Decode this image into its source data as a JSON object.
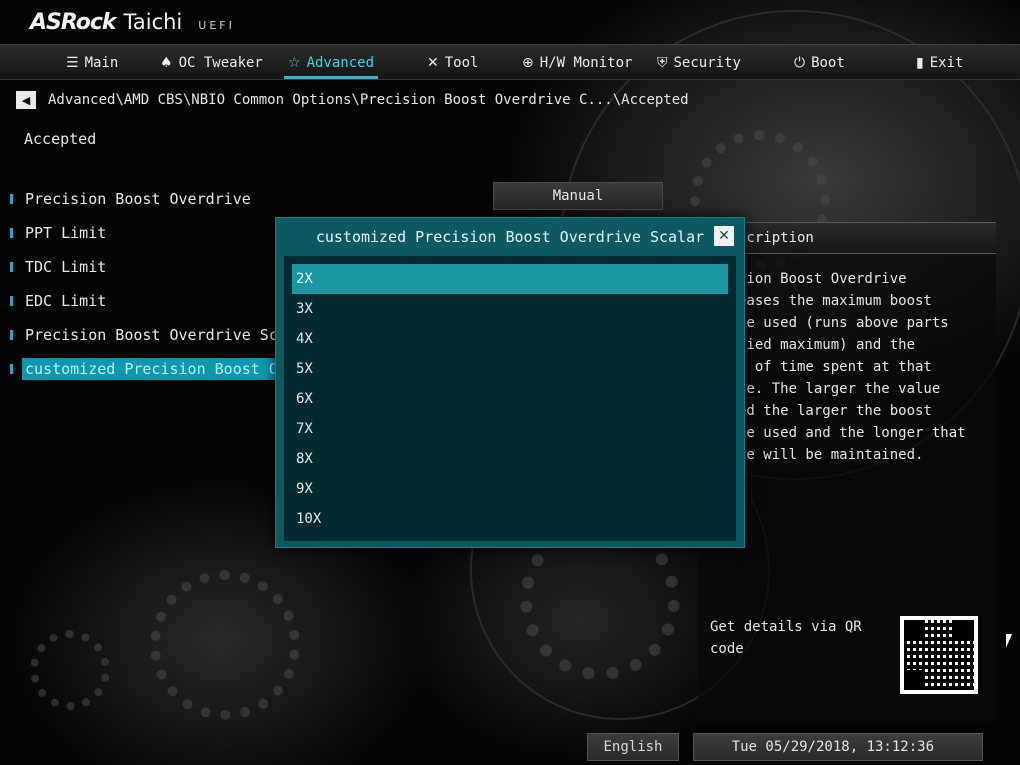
{
  "header": {
    "brand": "ASRock",
    "model": "Taichi",
    "firmware": "UEFI"
  },
  "menu": {
    "tabs": [
      {
        "label": "Main",
        "icon": "list-icon"
      },
      {
        "label": "OC Tweaker",
        "icon": "rocket-icon"
      },
      {
        "label": "Advanced",
        "icon": "star-icon",
        "active": true
      },
      {
        "label": "Tool",
        "icon": "tools-icon"
      },
      {
        "label": "H/W Monitor",
        "icon": "crosshair-icon"
      },
      {
        "label": "Security",
        "icon": "shield-icon"
      },
      {
        "label": "Boot",
        "icon": "power-icon"
      },
      {
        "label": "Exit",
        "icon": "exit-door-icon"
      }
    ]
  },
  "breadcrumb": {
    "path": "Advanced\\AMD CBS\\NBIO Common Options\\Precision Boost Overdrive C...\\Accepted"
  },
  "page": {
    "title": "Accepted"
  },
  "settings": {
    "items": [
      {
        "label": "Precision Boost Overdrive",
        "value": "Manual"
      },
      {
        "label": "PPT Limit"
      },
      {
        "label": "TDC Limit"
      },
      {
        "label": "EDC Limit"
      },
      {
        "label": "Precision Boost Overdrive Scala"
      },
      {
        "label": "customized Precision Boost Over",
        "selected": true
      }
    ]
  },
  "description": {
    "heading": "scription",
    "text": "sion Boost Overdrive\neases the maximum boost\nge used (runs above parts\nfied maximum) and the\nt of time spent at that\nge. The larger the value\ned the larger the boost\nge used and the longer that\nge will be maintained.",
    "qr_caption": "Get details via QR code"
  },
  "popup": {
    "title": "customized Precision Boost Overdrive Scalar",
    "close_label": "✕",
    "options": [
      "2X",
      "3X",
      "4X",
      "5X",
      "6X",
      "7X",
      "8X",
      "9X",
      "10X"
    ],
    "selected": "2X"
  },
  "footer": {
    "language": "English",
    "datetime": "Tue 05/29/2018, 13:12:36"
  },
  "colors": {
    "accent": "#2fb8cc",
    "popup_bg": "#0d5a60",
    "popup_list_bg": "#022c30",
    "selection": "#1c96a0"
  }
}
